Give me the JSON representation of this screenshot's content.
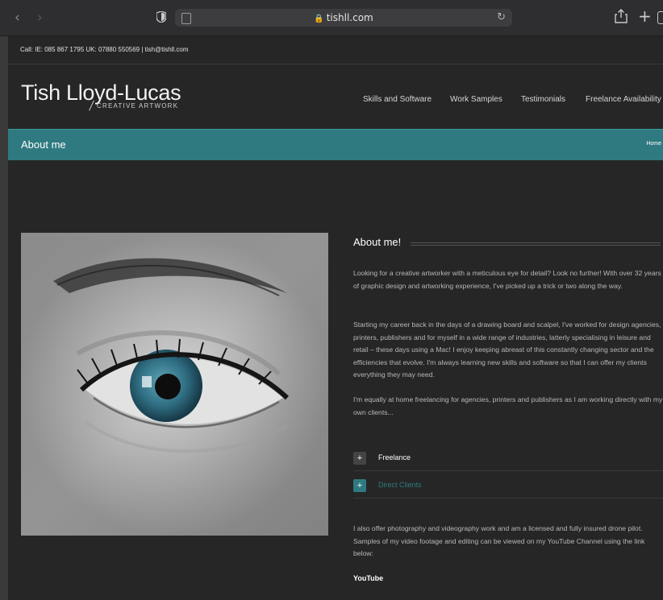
{
  "browser": {
    "url": "tishll.com"
  },
  "topbar": {
    "contact": "Call: IE: 085 867 1795 UK: 07880 550569  |  tish@tishll.com"
  },
  "header": {
    "logo_name": "Tish Lloyd-Lucas",
    "logo_sub": "CREATIVE ARTWORK",
    "nav": [
      "Skills and Software",
      "Work Samples",
      "Testimonials",
      "Freelance Availability"
    ]
  },
  "titlebar": {
    "title": "About me",
    "breadcrumb": "Home"
  },
  "about": {
    "heading": "About me!",
    "p1": "Looking for a creative artworker with a meticulous eye for detail? Look no further! With over 32 years of graphic design and artworking experience, I've picked up a trick or two along the way.",
    "p2": "Starting my career back in the days of a drawing board and scalpel, I've worked for design agencies, printers, publishers and for myself in a wide range of industries, latterly specialising in leisure and retail – these days using a Mac! I enjoy keeping abreast of this constantly changing sector and the efficiencies that evolve. I'm always learning new skills and software so that I can offer my clients everything they may need.",
    "p3": "I'm equally at home freelancing for agencies, printers and publishers as I am working directly with my own clients...",
    "accordion": [
      {
        "label": "Freelance",
        "toggle": "+"
      },
      {
        "label": "Direct Clients",
        "toggle": "+"
      }
    ],
    "p4": "I also offer photography and videography work and am a licensed and fully insured drone pilot. Samples of my video footage and editing can be viewed on my YouTube Channel using the link below:",
    "youtube_link": "YouTube"
  },
  "colors": {
    "accent": "#2f7a80",
    "page_bg": "#262626"
  }
}
